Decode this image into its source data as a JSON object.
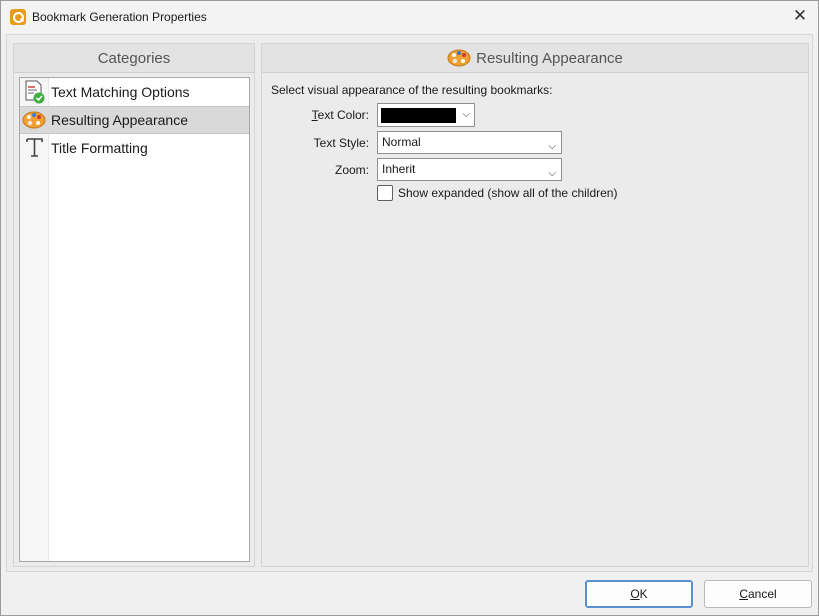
{
  "window": {
    "title": "Bookmark Generation Properties",
    "close_glyph": "✕"
  },
  "categories": {
    "header": "Categories",
    "items": [
      {
        "label": "Text Matching Options",
        "icon": "text-matching-icon",
        "selected": false
      },
      {
        "label": "Resulting Appearance",
        "icon": "palette-icon",
        "selected": true
      },
      {
        "label": "Title Formatting",
        "icon": "title-t-icon",
        "selected": false
      }
    ]
  },
  "appearance": {
    "header": "Resulting Appearance",
    "description": "Select visual appearance of the resulting bookmarks:",
    "text_color_label_accel": "T",
    "text_color_label_rest": "ext Color:",
    "text_color_value": "#000000",
    "text_style_label": "Text Style:",
    "text_style_value": "Normal",
    "zoom_label": "Zoom:",
    "zoom_value": "Inherit",
    "show_expanded_label": "Show expanded (show all of the children)",
    "show_expanded_checked": false
  },
  "buttons": {
    "ok_accel": "O",
    "ok_rest": "K",
    "cancel_accel": "C",
    "cancel_rest": "ancel"
  },
  "colors": {
    "accent": "#5a8fd0",
    "palette": "#f0a030",
    "check_green": "#3fae3f"
  }
}
